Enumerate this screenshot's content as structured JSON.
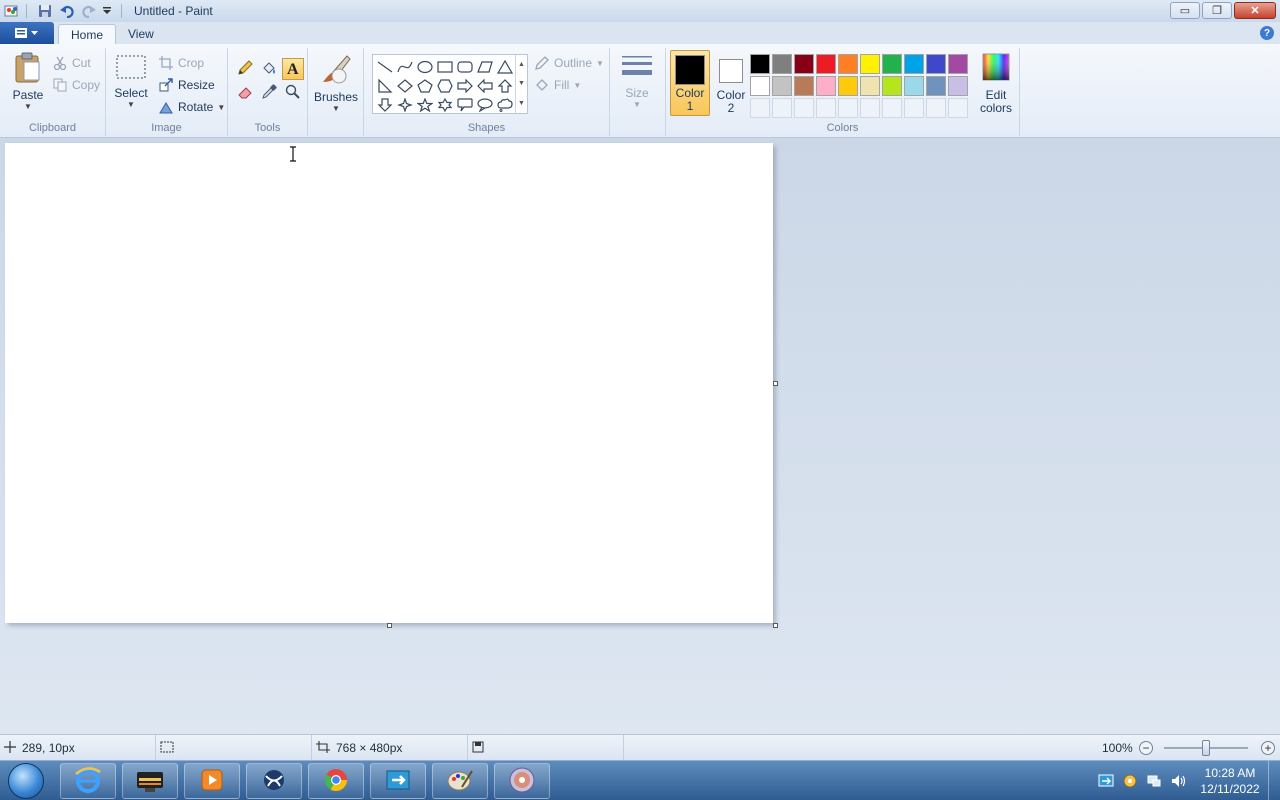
{
  "window": {
    "title": "Untitled - Paint",
    "minimize": "▭",
    "restore": "❐",
    "close": "✕"
  },
  "tabs": [
    {
      "label": "Home"
    },
    {
      "label": "View"
    }
  ],
  "help": "?",
  "clipboard": {
    "group_label": "Clipboard",
    "paste": "Paste",
    "cut": "Cut",
    "copy": "Copy"
  },
  "image": {
    "group_label": "Image",
    "select": "Select",
    "crop": "Crop",
    "resize": "Resize",
    "rotate": "Rotate"
  },
  "tools": {
    "group_label": "Tools",
    "active_tool": "text"
  },
  "brushes": {
    "label": "Brushes"
  },
  "shapes": {
    "group_label": "Shapes",
    "outline": "Outline",
    "fill": "Fill"
  },
  "size": {
    "label": "Size"
  },
  "colors": {
    "group_label": "Colors",
    "color1_line1": "Color",
    "color1_line2": "1",
    "color2_line1": "Color",
    "color2_line2": "2",
    "color1_value": "#000000",
    "color2_value": "#ffffff",
    "edit_line1": "Edit",
    "edit_line2": "colors",
    "palette_row1": [
      "#000000",
      "#7f7f7f",
      "#880015",
      "#ed1c24",
      "#ff7f27",
      "#fff200",
      "#22b14c",
      "#00a2e8",
      "#3f48cc",
      "#a349a4"
    ],
    "palette_row2": [
      "#ffffff",
      "#c3c3c3",
      "#b97a57",
      "#ffaec9",
      "#ffc90e",
      "#efe4b0",
      "#b5e61d",
      "#99d9ea",
      "#7092be",
      "#c8bfe7"
    ]
  },
  "status": {
    "cursor_pos": "289, 10px",
    "canvas_size": "768 × 480px",
    "zoom": "100%",
    "zoom_level": 0.5
  },
  "taskbar": {
    "time": "10:28 AM",
    "date": "12/11/2022"
  }
}
